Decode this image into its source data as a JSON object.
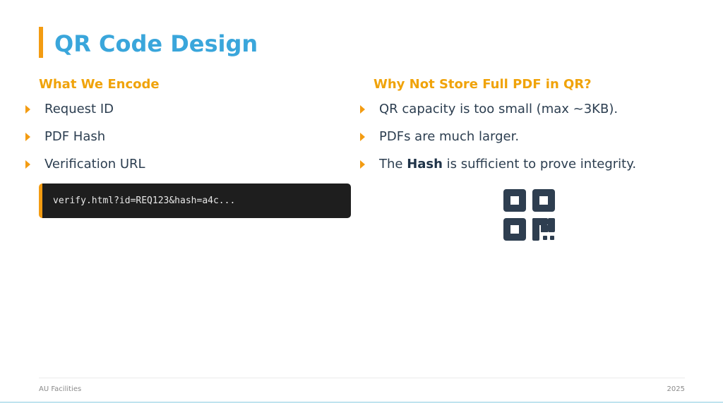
{
  "slide": {
    "title": "QR Code Design",
    "left": {
      "heading": "What We Encode",
      "items": [
        "Request ID",
        "PDF Hash",
        "Verification URL"
      ],
      "code": "verify.html?id=REQ123&hash=a4c..."
    },
    "right": {
      "heading": "Why Not Store Full PDF in QR?",
      "items": [
        "QR capacity is too small (max ~3KB).",
        "PDFs are much larger."
      ],
      "item3": {
        "before": "The ",
        "bold": "Hash",
        "after": " is sufficient to prove integrity."
      }
    },
    "icon": "qr-code-icon"
  },
  "footer": {
    "left": "AU Facilities",
    "right": "2025"
  },
  "colors": {
    "accent": "#f39c12",
    "title": "#3aa6db",
    "heading": "#f0a30a",
    "text": "#2c3e50",
    "icon": "#2e3e50"
  }
}
